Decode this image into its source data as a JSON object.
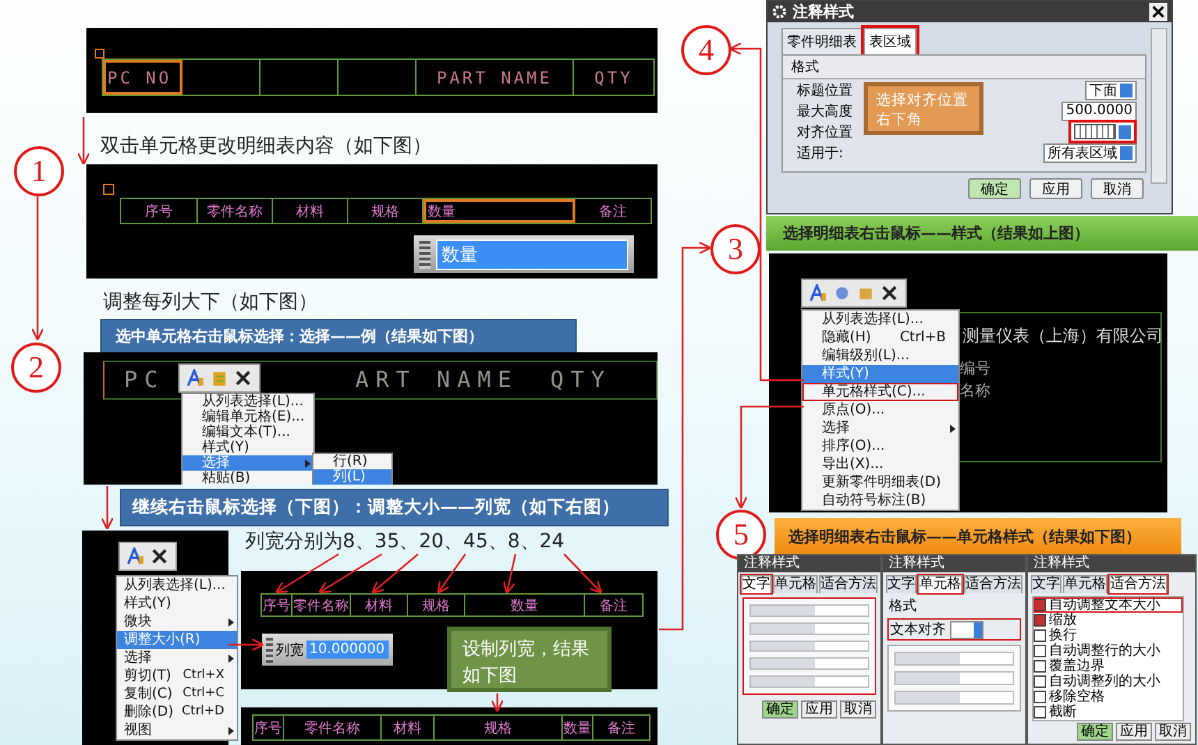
{
  "step_markers": [
    "1",
    "2",
    "3",
    "4",
    "5"
  ],
  "step1": {
    "header_table": [
      {
        "text": "PC NO",
        "highlighted": true
      },
      {
        "highlighted": false
      },
      {
        "highlighted": false
      },
      {
        "highlighted": false
      },
      {
        "text": "PART NAME",
        "highlighted": false
      },
      {
        "text": "QTY",
        "highlighted": false
      }
    ],
    "caption": "双击单元格更改明细表内容（如下图）",
    "cn_table": [
      {
        "text": "序号",
        "highlighted": false
      },
      {
        "text": "零件名称",
        "highlighted": false
      },
      {
        "text": "材料",
        "highlighted": false
      },
      {
        "text": "规格",
        "highlighted": false
      },
      {
        "text": "数量",
        "highlighted": true
      },
      {
        "text": "备注",
        "highlighted": false
      }
    ],
    "edit_field": {
      "value": "数量"
    }
  },
  "step2": {
    "caption": "调整每列大下（如下图）",
    "banner": "选中单元格右击鼠标选择：选择——例（结果如下图）",
    "table_texts": [
      "PC",
      "ART NAME",
      "QTY"
    ],
    "menu": [
      {
        "label": "从列表选择(L)...",
        "selected": false,
        "submenu": false
      },
      {
        "label": "编辑单元格(E)...",
        "selected": false,
        "submenu": false
      },
      {
        "label": "编辑文本(T)...",
        "selected": false,
        "submenu": false
      },
      {
        "label": "样式(Y)",
        "selected": false,
        "submenu": false
      },
      {
        "label": "选择",
        "selected": true,
        "submenu": true
      },
      {
        "label": "粘贴(B)",
        "selected": false,
        "submenu": false
      }
    ],
    "submenu": [
      {
        "label": "行(R)",
        "selected": false
      },
      {
        "label": "列(L)",
        "selected": true
      }
    ]
  },
  "step3": {
    "banner": "继续右击鼠标选择（下图）：调整大小——列宽（如下右图）",
    "menu": [
      {
        "label": "从列表选择(L)...",
        "selected": false,
        "submenu": false
      },
      {
        "label": "样式(Y)",
        "selected": false,
        "submenu": false
      },
      {
        "label": "微块",
        "selected": false,
        "submenu": true
      },
      {
        "label": "调整大小(R)",
        "selected": true,
        "submenu": false
      },
      {
        "label": "选择",
        "selected": false,
        "submenu": true
      },
      {
        "label": "剪切(T)",
        "shortcut": "Ctrl+X",
        "selected": false,
        "submenu": false
      },
      {
        "label": "复制(C)",
        "shortcut": "Ctrl+C",
        "selected": false,
        "submenu": false
      },
      {
        "label": "删除(D)",
        "shortcut": "Ctrl+D",
        "selected": false,
        "submenu": false
      },
      {
        "label": "视图",
        "selected": false,
        "submenu": true
      }
    ],
    "widths_note": "列宽分别为8、35、20、45、8、24",
    "before_table": [
      "序号",
      "零件名称",
      "材料",
      "规格",
      "数量",
      "备注"
    ],
    "width_field": {
      "label": "列宽",
      "value": "10.000000"
    },
    "callout": "设制列宽，结果如下图",
    "after_table": [
      "序号",
      "零件名称",
      "材料",
      "规格",
      "数量",
      "备注"
    ]
  },
  "style_dialog": {
    "title": "注释样式",
    "tabs": [
      {
        "label": "零件明细表",
        "selected": false,
        "highlighted": false
      },
      {
        "label": "表区域",
        "selected": true,
        "highlighted": true
      }
    ],
    "section": "格式",
    "rows": [
      {
        "label": "标题位置",
        "kind": "dropdown",
        "value": "下面"
      },
      {
        "label": "最大高度",
        "kind": "input",
        "value": "500.0000"
      },
      {
        "label": "对齐位置",
        "kind": "align",
        "highlighted": true
      },
      {
        "label": "适用于:",
        "kind": "dropdown",
        "value": "所有表区域"
      }
    ],
    "callout": "选择对齐位置右下角",
    "buttons": [
      "确定",
      "应用",
      "取消"
    ]
  },
  "style_banner": "选择明细表右击鼠标——样式（结果如上图）",
  "step4": {
    "drawing_texts": [
      "测量仪表（上海）有限公司",
      "编号",
      "名称"
    ],
    "menu": [
      {
        "label": "从列表选择(L)...",
        "selected": false,
        "highlighted": false,
        "submenu": false
      },
      {
        "label": "隐藏(H)",
        "shortcut": "Ctrl+B",
        "selected": false,
        "highlighted": false,
        "submenu": false
      },
      {
        "label": "编辑级别(L)...",
        "selected": false,
        "highlighted": false,
        "submenu": false
      },
      {
        "label": "样式(Y)",
        "selected": true,
        "highlighted": false,
        "submenu": false
      },
      {
        "label": "单元格样式(C)...",
        "selected": false,
        "highlighted": true,
        "submenu": false
      },
      {
        "label": "原点(O)...",
        "selected": false,
        "highlighted": false,
        "submenu": false
      },
      {
        "label": "选择",
        "selected": false,
        "highlighted": false,
        "submenu": true
      },
      {
        "label": "排序(O)...",
        "selected": false,
        "highlighted": false,
        "submenu": false
      },
      {
        "label": "导出(X)...",
        "selected": false,
        "highlighted": false,
        "submenu": false
      },
      {
        "label": "更新零件明细表(D)",
        "selected": false,
        "highlighted": false,
        "submenu": false
      },
      {
        "label": "自动符号标注(B)",
        "selected": false,
        "highlighted": false,
        "submenu": false
      }
    ]
  },
  "cell_style_banner": "选择明细表右击鼠标——单元格样式（结果如下图）",
  "cell_style_dialogs": [
    {
      "title": "注释样式",
      "tabs": [
        {
          "label": "文字",
          "selected": true
        },
        {
          "label": "单元格",
          "selected": false
        },
        {
          "label": "适合方法",
          "selected": false
        }
      ],
      "kind": "text",
      "buttons": [
        "确定",
        "应用",
        "取消"
      ]
    },
    {
      "title": "注释样式",
      "tabs": [
        {
          "label": "文字",
          "selected": false
        },
        {
          "label": "单元格",
          "selected": true
        },
        {
          "label": "适合方法",
          "selected": false
        }
      ],
      "kind": "cell",
      "section": "格式",
      "align_label": "文本对齐"
    },
    {
      "title": "注释样式",
      "tabs": [
        {
          "label": "文字",
          "selected": false
        },
        {
          "label": "单元格",
          "selected": false
        },
        {
          "label": "适合方法",
          "selected": true
        }
      ],
      "kind": "fit",
      "options": [
        {
          "label": "自动调整文本大小",
          "checked": true
        },
        {
          "label": "缩放",
          "checked": true
        },
        {
          "label": "换行",
          "checked": false
        },
        {
          "label": "自动调整行的大小",
          "checked": false
        },
        {
          "label": "覆盖边界",
          "checked": false
        },
        {
          "label": "自动调整列的大小",
          "checked": false
        },
        {
          "label": "移除空格",
          "checked": false
        },
        {
          "label": "截断",
          "checked": false
        }
      ],
      "buttons": [
        "确定",
        "应用",
        "取消"
      ]
    }
  ]
}
